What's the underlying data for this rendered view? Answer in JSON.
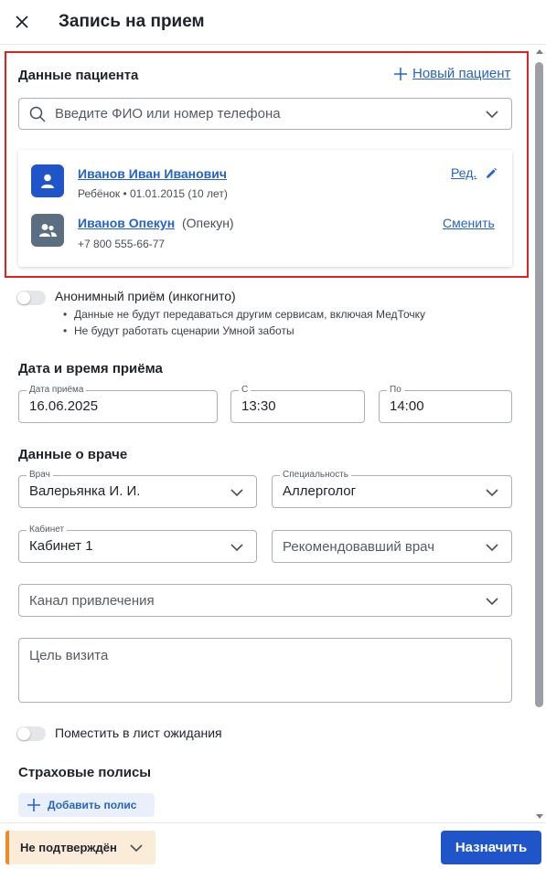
{
  "header": {
    "title": "Запись на прием"
  },
  "patient": {
    "section_title": "Данные пациента",
    "new_patient_label": "Новый пациент",
    "search_placeholder": "Введите ФИО или номер телефона",
    "main": {
      "name": "Иванов Иван Иванович",
      "meta": "Ребёнок • 01.01.2015 (10 лет)",
      "action": "Ред."
    },
    "guardian": {
      "name": "Иванов Опекун",
      "role": "(Опекун)",
      "phone": "+7 800 555-66-77",
      "action": "Сменить"
    }
  },
  "anonymous": {
    "label": "Анонимный приём (инкогнито)",
    "notes": [
      "Данные не будут передаваться другим сервисам, включая МедТочку",
      "Не будут работать сценарии Умной заботы"
    ]
  },
  "datetime": {
    "section_title": "Дата и время приёма",
    "date": {
      "label": "Дата приёма",
      "value": "16.06.2025"
    },
    "from": {
      "label": "С",
      "value": "13:30"
    },
    "to": {
      "label": "По",
      "value": "14:00"
    }
  },
  "doctor": {
    "section_title": "Данные о враче",
    "doctor": {
      "label": "Врач",
      "value": "Валерьянка И. И."
    },
    "specialty": {
      "label": "Специальность",
      "value": "Аллерголог"
    },
    "cabinet": {
      "label": "Кабинет",
      "value": "Кабинет 1"
    },
    "referring": {
      "placeholder": "Рекомендовавший врач"
    }
  },
  "channel": {
    "placeholder": "Канал привлечения"
  },
  "visit_purpose": {
    "placeholder": "Цель визита"
  },
  "waitlist": {
    "label": "Поместить в лист ожидания"
  },
  "insurance": {
    "section_title": "Страховые полисы",
    "add_label": "Добавить полис"
  },
  "footer": {
    "status": "Не подтверждён",
    "submit": "Назначить"
  },
  "colors": {
    "accent": "#1f55c8",
    "link": "#2563c9",
    "highlight_border": "#e4211e",
    "status_bg": "#fbecd9",
    "status_stripe": "#f08a24"
  }
}
